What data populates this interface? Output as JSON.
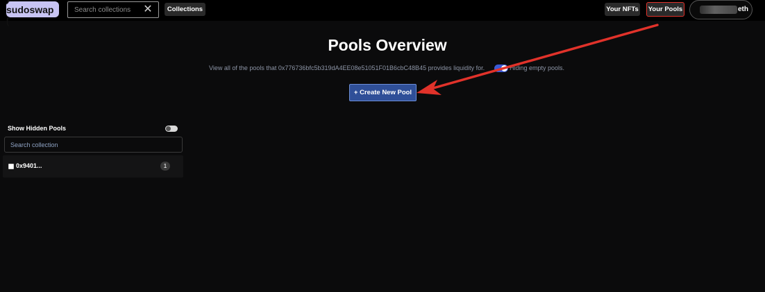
{
  "header": {
    "logo_text": "⟯ sudoswap ⟮",
    "search": {
      "placeholder": "Search collections",
      "value": ""
    },
    "clear_icon": "close-icon",
    "collections_label": "Collections",
    "your_nfts_label": "Your NFTs",
    "your_pools_label": "Your Pools",
    "wallet_suffix": "eth"
  },
  "main": {
    "title": "Pools Overview",
    "subtitle": "View all of the pools that 0x776736bfc5b319dA4EE08e51051F01B6cbC48B45 provides liquidity for.",
    "hiding_label": "Hiding empty pools.",
    "create_button_label": "+ Create New Pool"
  },
  "sidebar": {
    "show_hidden_label": "Show Hidden Pools",
    "search_placeholder": "Search collection",
    "items": [
      {
        "address": "0x9401...",
        "count": "1"
      }
    ]
  },
  "colors": {
    "accent_red": "#e1322a",
    "button_blue": "#2f4f98",
    "logo_bg": "#c8c4f3"
  }
}
